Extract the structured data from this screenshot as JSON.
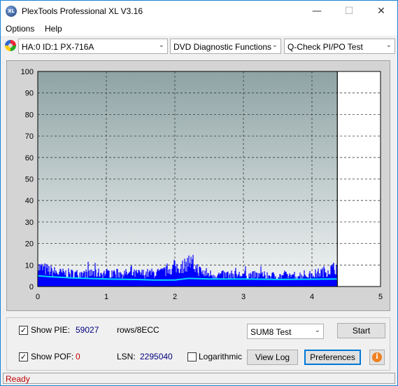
{
  "window": {
    "title": "PlexTools Professional XL V3.16",
    "app_icon_text": "XL",
    "minimize": "—",
    "maximize": "☐",
    "close": "✕"
  },
  "menu": {
    "options": "Options",
    "help": "Help"
  },
  "toolbar": {
    "drive": "HA:0 ID:1  PX-716A",
    "function": "DVD Diagnostic Functions",
    "test": "Q-Check PI/PO Test",
    "dropdown_arrow": "⌄"
  },
  "chart_data": {
    "type": "area",
    "x_ticks": [
      "0",
      "1",
      "2",
      "3",
      "4",
      "5"
    ],
    "y_ticks": [
      "0",
      "10",
      "20",
      "30",
      "40",
      "50",
      "60",
      "70",
      "80",
      "90",
      "100"
    ],
    "xlim": [
      0,
      5
    ],
    "ylim": [
      0,
      100
    ],
    "grid": true,
    "scan_end_x": 4.37,
    "colors": {
      "plot_bg_top": "#8ea3a5",
      "plot_bg_bottom": "#f2f4f4",
      "pie_bars": "#0000ff",
      "sum_line": "#00d8ff",
      "grid": "#3a3a3a",
      "panel": "#d4d4d4"
    },
    "series": [
      {
        "key": "pie",
        "profile_x": [
          0,
          0.1,
          0.3,
          0.6,
          1.0,
          1.4,
          1.8,
          1.9,
          2.05,
          2.15,
          2.2,
          2.3,
          2.4,
          2.6,
          3.0,
          3.5,
          4.0,
          4.2,
          4.37
        ],
        "profile_y": [
          10,
          9,
          7,
          6.5,
          7,
          6.5,
          7,
          9,
          10,
          11,
          13,
          10,
          7,
          6,
          6,
          5.5,
          6,
          8,
          10
        ]
      },
      {
        "key": "sum8",
        "x": [
          0,
          0.2,
          0.5,
          1.0,
          1.5,
          1.7,
          2.0,
          2.2,
          2.5,
          3.0,
          3.5,
          4.0,
          4.37
        ],
        "y": [
          5,
          4.5,
          4,
          3.5,
          3.2,
          3,
          3,
          3.8,
          3.5,
          3.5,
          3.3,
          3.4,
          3.5
        ]
      }
    ]
  },
  "controls": {
    "show_pie_label": "Show PIE:",
    "pie_value": "59027",
    "rows_label": "rows/8ECC",
    "show_pof_label": "Show POF:",
    "pof_value": "0",
    "lsn_label": "LSN:",
    "lsn_value": "2295040",
    "logarithmic_label": "Logarithmic",
    "show_pie_checked": "✓",
    "show_pof_checked": "✓",
    "test_select": "SUM8 Test",
    "start": "Start",
    "view_log": "View Log",
    "preferences": "Preferences",
    "info_icon_glyph": "i"
  },
  "status": {
    "text": "Ready"
  }
}
